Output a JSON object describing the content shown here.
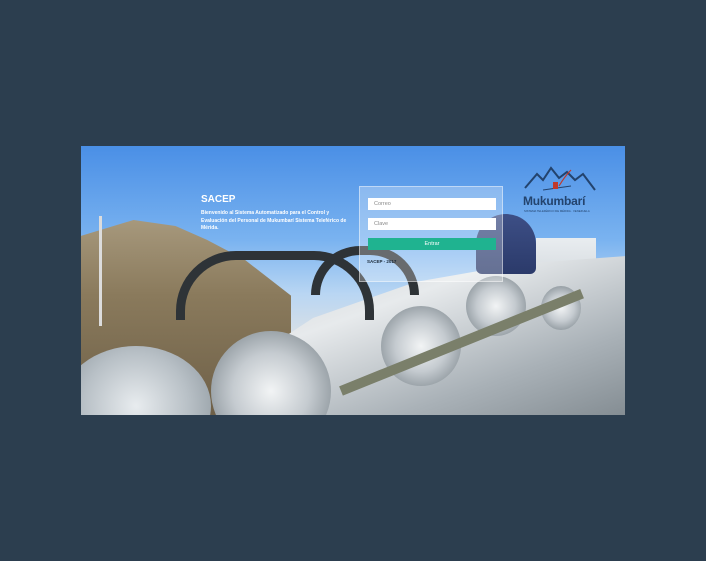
{
  "intro": {
    "title": "SACEP",
    "description": "Bienvenido al Sistema Automatizado para el Control y Evaluación del Personal de Mukumbarí Sistema Teleférico de Mérida."
  },
  "login": {
    "email_placeholder": "Correo",
    "password_placeholder": "Clave",
    "submit_label": "Entrar",
    "footer": "SACEP - 2017"
  },
  "logo": {
    "name": "Mukumbarí",
    "subtitle": "SISTEMA TELEFÉRICO DE MÉRIDA · VENEZUELA"
  },
  "colors": {
    "page_background": "#2c3e4f",
    "accent_button": "#1fb390",
    "logo_text": "#23436d"
  }
}
